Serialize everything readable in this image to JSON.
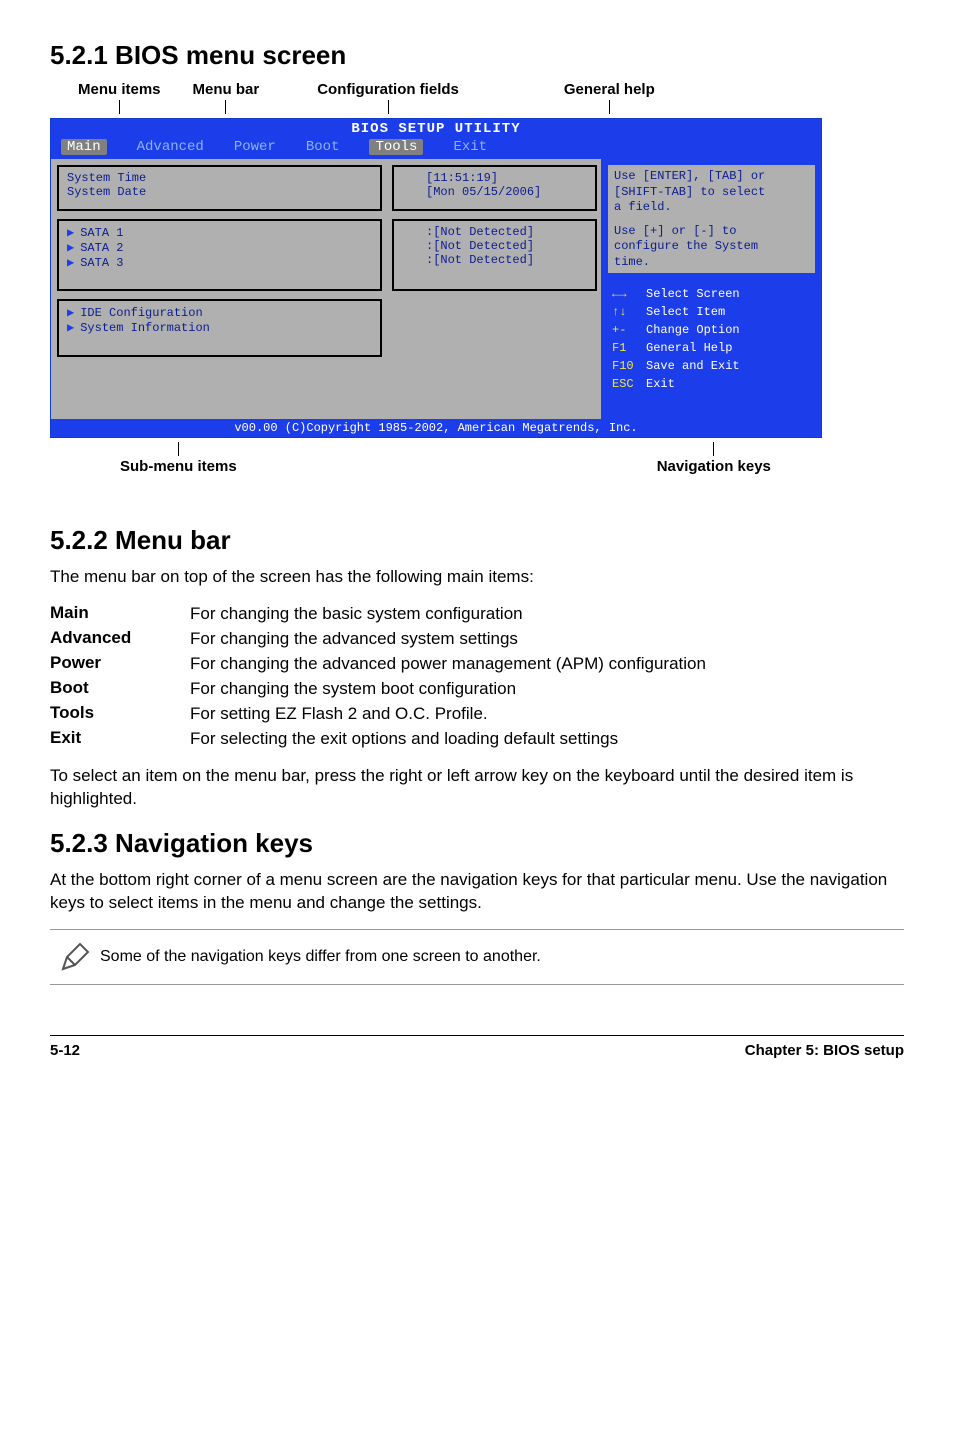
{
  "section521": {
    "heading": "5.2.1   BIOS menu screen",
    "topLabels": {
      "menuItems": "Menu items",
      "menuBar": "Menu bar",
      "configFields": "Configuration fields",
      "generalHelp": "General help"
    },
    "bios": {
      "title": "BIOS SETUP UTILITY",
      "tabs": {
        "main": "Main",
        "advanced": "Advanced",
        "power": "Power",
        "boot": "Boot",
        "tools": "Tools",
        "exit": "Exit"
      },
      "left": {
        "systemTime": "System Time",
        "systemDate": "System Date",
        "sata1": "SATA 1",
        "sata2": "SATA 2",
        "sata3": "SATA 3",
        "ideConfig": "IDE Configuration",
        "sysInfo": "System Information"
      },
      "mid": {
        "time": "[11:51:19]",
        "date": "[Mon 05/15/2006]",
        "nd1": ":[Not Detected]",
        "nd2": ":[Not Detected]",
        "nd3": ":[Not Detected]"
      },
      "help": {
        "line1": "Use [ENTER], [TAB] or",
        "line2": "[SHIFT-TAB] to select",
        "line3": "a field.",
        "line4": "Use [+] or [-] to",
        "line5": "configure the System",
        "line6": "time."
      },
      "nav": {
        "selectScreen": "Select Screen",
        "selectItem": "Select Item",
        "changeOption": "Change Option",
        "generalHelp": "General Help",
        "saveExit": "Save and Exit",
        "exit": "Exit",
        "kArrows": "←→",
        "kUpDown": "↑↓",
        "kPM": "+-",
        "kF1": "F1",
        "kF10": "F10",
        "kESC": "ESC"
      },
      "footer": "v00.00 (C)Copyright 1985-2002, American Megatrends, Inc."
    },
    "bottomLabels": {
      "subMenu": "Sub-menu items",
      "navKeys": "Navigation keys"
    }
  },
  "section522": {
    "heading": "5.2.2   Menu bar",
    "intro": "The menu bar on top of the screen has the following main items:",
    "defs": [
      {
        "term": "Main",
        "desc": "For changing the basic system configuration"
      },
      {
        "term": "Advanced",
        "desc": "For changing the advanced system settings"
      },
      {
        "term": "Power",
        "desc": "For changing the advanced power management (APM) configuration"
      },
      {
        "term": "Boot",
        "desc": "For changing the system boot configuration"
      },
      {
        "term": "Tools",
        "desc": "For setting EZ Flash 2 and O.C. Profile."
      },
      {
        "term": "Exit",
        "desc": "For selecting the exit options and loading default settings"
      }
    ],
    "outro": "To select an item on the menu bar, press the right or left arrow key on the keyboard until the desired item is highlighted."
  },
  "section523": {
    "heading": "5.2.3   Navigation keys",
    "body": "At the bottom right corner of a menu screen are the navigation keys for that particular menu. Use the navigation keys to select items in the menu and change the settings.",
    "note": "Some of the navigation keys differ from one screen to another."
  },
  "footer": {
    "left": "5-12",
    "right": "Chapter 5: BIOS setup"
  }
}
